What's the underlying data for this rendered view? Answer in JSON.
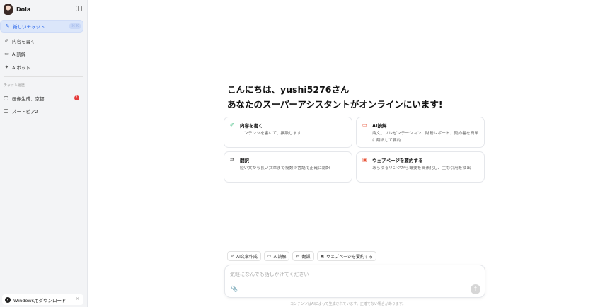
{
  "app": {
    "name": "Dola"
  },
  "sidebar": {
    "new_chat": {
      "label": "新しいチャット",
      "shortcut": "⌘ K"
    },
    "items": [
      {
        "label": "内容を書く",
        "icon": "pen-sparkle-icon"
      },
      {
        "label": "AI読解",
        "icon": "book-icon"
      },
      {
        "label": "AIボット",
        "icon": "sparkle-icon"
      }
    ],
    "history_label": "チャット履歴",
    "history": [
      {
        "label": "画像生成：京都",
        "badge": "!"
      },
      {
        "label": "ズートピア2"
      }
    ],
    "download": {
      "label": "Windows用ダウンロード",
      "close": "×"
    }
  },
  "main": {
    "greeting_line1": "こんにちは、yushi5276さん",
    "greeting_line2": "あなたのスーパーアシスタントがオンラインにいます!",
    "cards": [
      {
        "title": "内容を書く",
        "desc": "コンテンツを書いて、推敲します",
        "icon": "pen-sparkle-icon",
        "color": "#2bb673"
      },
      {
        "title": "AI読解",
        "desc": "論文、プレゼンテーション、財務レポート、契約書を簡単に翻訳して要約",
        "icon": "book-icon",
        "color": "#e8553a"
      },
      {
        "title": "翻訳",
        "desc": "短い文から長い文章まで複数の言語で正確に翻訳",
        "icon": "translate-icon",
        "color": "#555555"
      },
      {
        "title": "ウェブページを要約する",
        "desc": "あらゆるリンクから概要を簡素化し、主な引用を抽出",
        "icon": "webpage-icon",
        "color": "#e8553a"
      }
    ],
    "chips": [
      {
        "label": "AI文章作成",
        "icon": "pen-sparkle-icon"
      },
      {
        "label": "AI読解",
        "icon": "book-icon"
      },
      {
        "label": "翻訳",
        "icon": "translate-icon"
      },
      {
        "label": "ウェブページを要約する",
        "icon": "webpage-icon"
      }
    ],
    "input": {
      "placeholder": "気軽になんでも話しかけてください"
    },
    "disclaimer": "コンテンツはAIによって生成されています。正確でない場合があります。"
  }
}
